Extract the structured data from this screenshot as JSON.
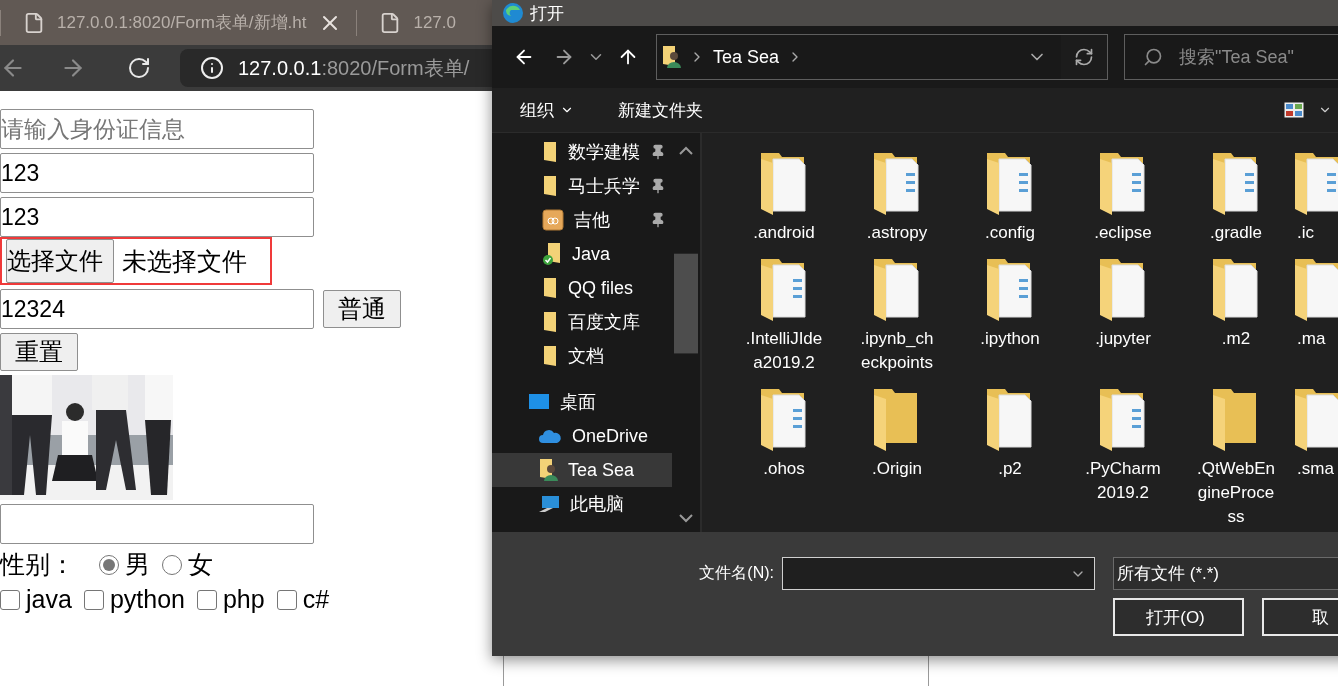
{
  "browser": {
    "tabs": [
      {
        "title": "127.0.0.1:8020/Form表单/新增.ht",
        "closable": true
      },
      {
        "title": "127.0",
        "closable": false
      }
    ],
    "address": {
      "host": "127.0.0.1",
      "path": ":8020/Form表单/"
    }
  },
  "form": {
    "rows": [
      {
        "kind": "input",
        "placeholder": "请输入身份证信息"
      },
      {
        "kind": "input",
        "value": "123"
      },
      {
        "kind": "input",
        "value": "123"
      },
      {
        "kind": "file",
        "button": "选择文件",
        "status": "未选择文件",
        "highlighted": true
      },
      {
        "kind": "input-button",
        "value": "12324",
        "button": "普通"
      },
      {
        "kind": "button",
        "label": "重置"
      },
      {
        "kind": "picture"
      },
      {
        "kind": "input"
      },
      {
        "kind": "radio",
        "label": "性别：",
        "options": [
          {
            "label": "男",
            "selected": true
          },
          {
            "label": "女",
            "selected": false
          }
        ]
      },
      {
        "kind": "checkboxes",
        "options": [
          {
            "label": "java",
            "checked": false
          },
          {
            "label": "python",
            "checked": false
          },
          {
            "label": "php",
            "checked": false
          },
          {
            "label": "c#",
            "checked": false
          }
        ]
      }
    ]
  },
  "dialog": {
    "title": "打开",
    "breadcrumb": [
      "Tea Sea"
    ],
    "search": {
      "placeholder": "搜索\"Tea Sea\""
    },
    "toolbar": [
      {
        "label": "组织",
        "dropdown": true
      },
      {
        "label": "新建文件夹",
        "dropdown": false
      }
    ],
    "sidebar": [
      {
        "label": "数学建模",
        "kind": "folder",
        "pinned": true,
        "selected": false
      },
      {
        "label": "马士兵学",
        "kind": "folder",
        "pinned": true,
        "selected": false
      },
      {
        "label": "吉他",
        "kind": "app-folder",
        "pinned": true,
        "selected": false
      },
      {
        "label": "Java",
        "kind": "synced-folder",
        "pinned": false,
        "selected": false
      },
      {
        "label": "QQ files",
        "kind": "folder",
        "pinned": false,
        "selected": false
      },
      {
        "label": "百度文库",
        "kind": "folder",
        "pinned": false,
        "selected": false
      },
      {
        "label": "文档",
        "kind": "folder",
        "pinned": false,
        "selected": false
      },
      {
        "label": "桌面",
        "kind": "desktop",
        "pinned": false,
        "selected": false
      },
      {
        "label": "OneDrive",
        "kind": "cloud",
        "pinned": false,
        "selected": false
      },
      {
        "label": "Tea Sea",
        "kind": "user",
        "pinned": false,
        "selected": true
      },
      {
        "label": "此电脑",
        "kind": "computer",
        "pinned": false,
        "selected": false
      }
    ],
    "files": [
      {
        "name": ".android",
        "kind": "blank"
      },
      {
        "name": ".astropy",
        "kind": "docs"
      },
      {
        "name": ".config",
        "kind": "docs"
      },
      {
        "name": ".eclipse",
        "kind": "docs"
      },
      {
        "name": ".gradle",
        "kind": "docs"
      },
      {
        "name": ".ic",
        "kind": "docs"
      },
      {
        "name": ".IntelliJIdea2019.2",
        "kind": "docs"
      },
      {
        "name": ".ipynb_checkpoints",
        "kind": "blank"
      },
      {
        "name": ".ipython",
        "kind": "docs"
      },
      {
        "name": ".jupyter",
        "kind": "blank"
      },
      {
        "name": ".m2",
        "kind": "blank"
      },
      {
        "name": ".ma",
        "kind": "blank"
      },
      {
        "name": ".ohos",
        "kind": "docs"
      },
      {
        "name": ".Origin",
        "kind": "empty"
      },
      {
        "name": ".p2",
        "kind": "blank"
      },
      {
        "name": ".PyCharm 2019.2",
        "kind": "docs"
      },
      {
        "name": ".QtWebEngineProcess",
        "kind": "empty"
      },
      {
        "name": ".sma",
        "kind": "blank"
      }
    ],
    "filename": {
      "label": "文件名(N):"
    },
    "filter": "所有文件 (*.*)",
    "buttons": [
      "打开(O)",
      "取"
    ]
  }
}
